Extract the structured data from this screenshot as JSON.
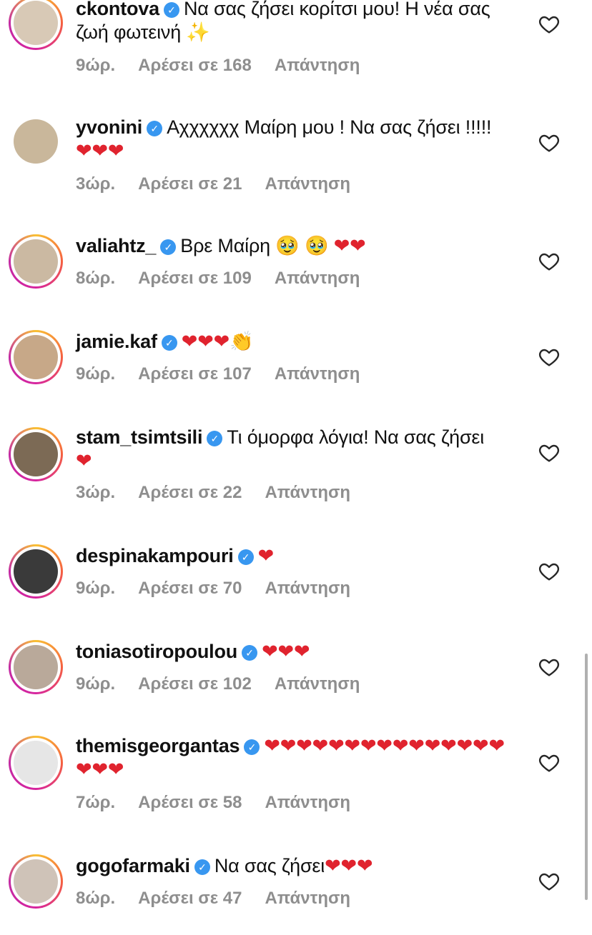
{
  "comments": [
    {
      "username": "ckontova",
      "text": "Να σας ζήσει κορίτσι μου! Η νέα σας ζωή φωτεινή ✨",
      "time": "9ώρ.",
      "likes": "Αρέσει σε 168",
      "reply": "Απάντηση",
      "avatar_color": "#d8c9b6"
    },
    {
      "username": "yvonini",
      "text": "Αχχχχχχ Μαίρη μου ! Να σας ζήσει !!!!! ❤❤❤",
      "time": "3ώρ.",
      "likes": "Αρέσει σε 21",
      "reply": "Απάντηση",
      "avatar_color": "#c9b79b"
    },
    {
      "username": "valiahtz_",
      "text": "Βρε Μαίρη 🥹 🥹 ❤❤",
      "time": "8ώρ.",
      "likes": "Αρέσει σε 109",
      "reply": "Απάντηση",
      "avatar_color": "#cbb9a2"
    },
    {
      "username": "jamie.kaf",
      "text": "❤❤❤👏",
      "time": "9ώρ.",
      "likes": "Αρέσει σε 107",
      "reply": "Απάντηση",
      "avatar_color": "#c7a888"
    },
    {
      "username": "stam_tsimtsili",
      "text": "Τι όμορφα λόγια! Να σας ζήσει ❤",
      "time": "3ώρ.",
      "likes": "Αρέσει σε 22",
      "reply": "Απάντηση",
      "avatar_color": "#7c6a55"
    },
    {
      "username": "despinakampouri",
      "text": "❤",
      "time": "9ώρ.",
      "likes": "Αρέσει σε 70",
      "reply": "Απάντηση",
      "avatar_color": "#3a3a3a"
    },
    {
      "username": "toniasotiropoulou",
      "text": "❤❤❤",
      "time": "9ώρ.",
      "likes": "Αρέσει σε 102",
      "reply": "Απάντηση",
      "avatar_color": "#b9a99a"
    },
    {
      "username": "themisgeorgantas",
      "text": "❤❤❤❤❤❤❤❤❤❤❤❤❤❤❤❤❤❤",
      "time": "7ώρ.",
      "likes": "Αρέσει σε 58",
      "reply": "Απάντηση",
      "avatar_color": "#e6e6e6"
    },
    {
      "username": "gogofarmaki",
      "text": "Να σας ζήσει❤❤❤",
      "time": "8ώρ.",
      "likes": "Αρέσει σε 47",
      "reply": "Απάντηση",
      "avatar_color": "#cfc3b8"
    }
  ],
  "icons": {
    "verified": "verified-check-icon",
    "like": "heart-outline-icon"
  },
  "colors": {
    "verified_blue": "#3897f0",
    "meta_gray": "#8e8e8e",
    "heart_red": "#e0232e"
  }
}
